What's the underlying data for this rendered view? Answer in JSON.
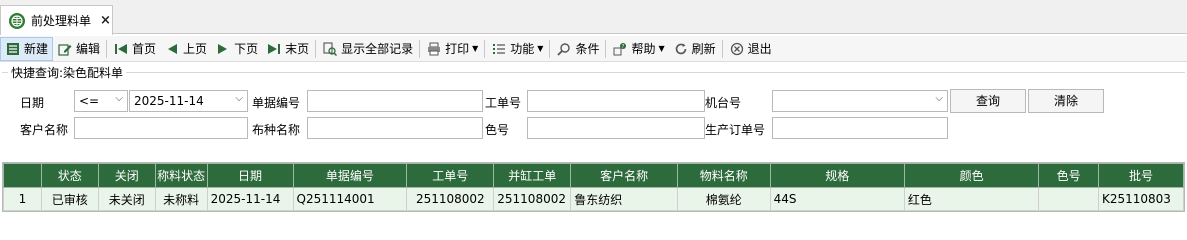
{
  "tab": {
    "title": "前处理料单",
    "close": "×"
  },
  "toolbar": [
    {
      "key": "new",
      "label": "新建",
      "icon": "new-icon"
    },
    {
      "key": "edit",
      "label": "编辑",
      "icon": "edit-icon"
    },
    {
      "key": "first",
      "label": "首页",
      "icon": "first-page-icon"
    },
    {
      "key": "prev",
      "label": "上页",
      "icon": "prev-page-icon"
    },
    {
      "key": "next",
      "label": "下页",
      "icon": "next-page-icon"
    },
    {
      "key": "last",
      "label": "末页",
      "icon": "last-page-icon"
    },
    {
      "key": "showall",
      "label": "显示全部记录",
      "icon": "search-all-icon"
    },
    {
      "key": "print",
      "label": "打印",
      "icon": "print-icon"
    },
    {
      "key": "func",
      "label": "功能",
      "icon": "list-icon"
    },
    {
      "key": "cond",
      "label": "条件",
      "icon": "search-icon"
    },
    {
      "key": "help",
      "label": "帮助",
      "icon": "help-icon"
    },
    {
      "key": "refresh",
      "label": "刷新",
      "icon": "refresh-icon"
    },
    {
      "key": "exit",
      "label": "退出",
      "icon": "exit-icon"
    }
  ],
  "query": {
    "title": "快捷查询:染色配料单",
    "date_label": "日期",
    "date_op": "<=",
    "date_value": "2025-11-14",
    "doc_no_label": "单据编号",
    "work_no_label": "工单号",
    "machine_label": "机台号",
    "customer_label": "客户名称",
    "fabric_label": "布种名称",
    "color_no_label": "色号",
    "prod_order_label": "生产订单号",
    "search_button": "查询",
    "clear_button": "清除"
  },
  "grid": {
    "columns": [
      "",
      "状态",
      "关闭",
      "称料状态",
      "日期",
      "单据编号",
      "工单号",
      "并缸工单",
      "客户名称",
      "物料名称",
      "规格",
      "颜色",
      "色号",
      "批号"
    ],
    "rows": [
      [
        "1",
        "已审核",
        "未关闭",
        "未称料",
        "2025-11-14",
        "Q251114001",
        "251108002",
        "251108002",
        "鲁东纺织",
        "棉氨纶",
        "44S",
        "红色",
        "",
        "K25110803"
      ]
    ]
  },
  "colors": {
    "header_green": "#2e6b3c",
    "accent_green": "#2e7d32"
  }
}
